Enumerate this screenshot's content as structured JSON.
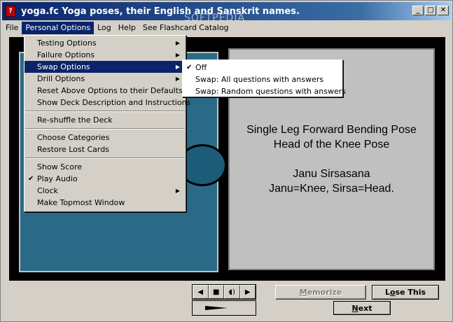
{
  "window": {
    "icon_text": "?",
    "title": "yoga.fc   Yoga poses, their English and Sanskrit names.",
    "minimize": "_",
    "maximize": "□",
    "close": "✕"
  },
  "menubar": [
    "File",
    "Personal Options",
    "Log",
    "Help",
    "See Flashcard Catalog"
  ],
  "watermark": "SOFTPEDIA",
  "dropdown": {
    "group1": [
      {
        "label": "Testing Options",
        "arrow": "▶"
      },
      {
        "label": "Failure Options",
        "arrow": "▶"
      },
      {
        "label": "Swap Options",
        "arrow": "▶"
      },
      {
        "label": "Drill Options",
        "arrow": "▶"
      },
      {
        "label": "Reset Above Options to their Defaults"
      },
      {
        "label": "Show Deck Description and Instructions"
      }
    ],
    "group2": [
      {
        "label": "Re-shuffle the Deck"
      }
    ],
    "group3": [
      {
        "label": "Choose Categories"
      },
      {
        "label": "Restore Lost Cards"
      }
    ],
    "group4": [
      {
        "label": "Show Score"
      },
      {
        "label": "Play Audio",
        "check": "✔"
      },
      {
        "label": "Clock",
        "arrow": "▶"
      },
      {
        "label": "Make Topmost Window"
      }
    ]
  },
  "submenu": [
    {
      "label": "Off",
      "check": "✔"
    },
    {
      "label": "Swap: All questions with answers"
    },
    {
      "label": "Swap: Random questions with answers"
    }
  ],
  "card": {
    "line1": "Single Leg Forward Bending Pose",
    "line2": "Head of the Knee Pose",
    "line3": "Janu Sirsasana",
    "line4": "Janu=Knee, Sirsa=Head."
  },
  "controls": {
    "memorize_pre": "",
    "memorize_ul": "M",
    "memorize_post": "emorize",
    "lose_pre": "L",
    "lose_ul": "o",
    "lose_post": "se This",
    "next_ul": "N",
    "next_post": "ext",
    "media": [
      "◀",
      "■",
      "◖)",
      "▶"
    ],
    "progress": 0.45
  }
}
